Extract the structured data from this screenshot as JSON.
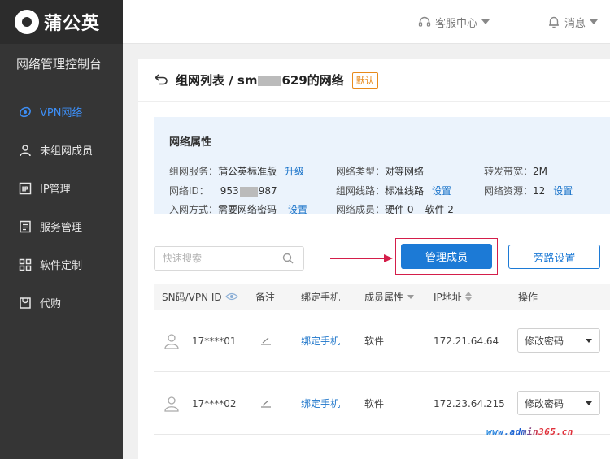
{
  "app": {
    "logo_text": "蒲公英",
    "console_title": "网络管理控制台"
  },
  "sidebar": {
    "items": [
      {
        "label": "VPN网络",
        "icon": "globe-icon",
        "active": true
      },
      {
        "label": "未组网成员",
        "icon": "user-icon"
      },
      {
        "label": "IP管理",
        "icon": "ip-icon"
      },
      {
        "label": "服务管理",
        "icon": "list-icon"
      },
      {
        "label": "软件定制",
        "icon": "grid-icon"
      },
      {
        "label": "代购",
        "icon": "cart-icon"
      }
    ]
  },
  "topbar": {
    "support_label": "客服中心",
    "messages_label": "消息"
  },
  "page": {
    "title_prefix": "组网列表 / sm",
    "title_suffix": "629的网络",
    "badge": "默认"
  },
  "attributes": {
    "title": "网络属性",
    "service_label": "组网服务：",
    "service_value": "蒲公英标准版",
    "service_link": "升级",
    "type_label": "网络类型：",
    "type_value": "对等网络",
    "bandwidth_label": "转发带宽：",
    "bandwidth_value": "2M",
    "id_label": "网络ID：",
    "id_prefix": "953",
    "id_suffix": "987",
    "line_label": "组网线路：",
    "line_value": "标准线路",
    "line_link": "设置",
    "resource_label": "网络资源：",
    "resource_value": "12",
    "resource_link": "设置",
    "join_label": "入网方式：",
    "join_value": "需要网络密码",
    "join_link": "设置",
    "members_label": "网络成员：",
    "members_hw": "硬件 0",
    "members_sw": "软件 2"
  },
  "search": {
    "placeholder": "快速搜索"
  },
  "buttons": {
    "manage_members": "管理成员",
    "bypass_settings": "旁路设置"
  },
  "table": {
    "headers": [
      "SN码/VPN ID",
      "备注",
      "绑定手机",
      "成员属性",
      "IP地址",
      "操作"
    ],
    "rows": [
      {
        "sn": "17****01",
        "bind": "绑定手机",
        "type": "软件",
        "ip": "172.21.64.64",
        "action": "修改密码"
      },
      {
        "sn": "17****02",
        "bind": "绑定手机",
        "type": "软件",
        "ip": "172.23.64.215",
        "action": "修改密码"
      }
    ]
  },
  "watermark": {
    "text": "www.admin365.cn"
  },
  "colors": {
    "sidebar_bg": "#353535",
    "accent": "#1c7ad6",
    "highlight": "#d41e4a",
    "badge": "#e88a1a",
    "card_bg": "#ebf3fc"
  }
}
